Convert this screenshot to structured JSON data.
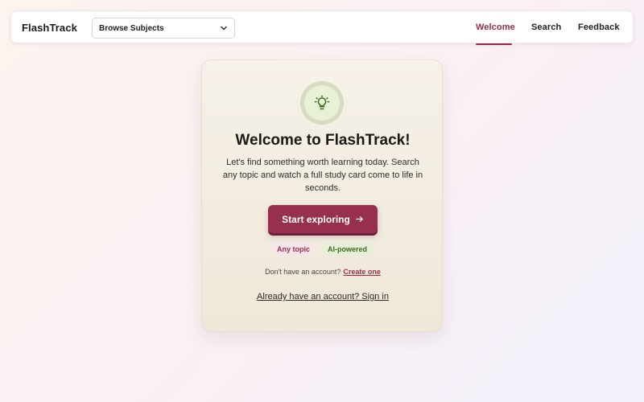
{
  "navbar": {
    "brand": "FlashTrack",
    "subject_select": {
      "selected": "Browse Subjects",
      "icon": "chevron-down-icon"
    },
    "links": [
      {
        "label": "Welcome",
        "active": true
      },
      {
        "label": "Search",
        "active": false
      },
      {
        "label": "Feedback",
        "active": false
      }
    ]
  },
  "welcome_card": {
    "icon": "lightbulb-icon",
    "title": "Welcome to FlashTrack!",
    "description": "Let's find something worth learning today. Search any topic and watch a full study card come to life in seconds.",
    "cta_label": "Start exploring",
    "cta_icon": "arrow-right-icon",
    "tags": [
      "Any topic",
      "AI-powered"
    ],
    "signup_prompt": "Don't have an account?",
    "signup_link": "Create one",
    "signin_link": "Already have an account? Sign in"
  },
  "colors": {
    "accent": "#97304f",
    "tag_pink_bg": "#f6e6ea",
    "tag_green_bg": "#e6efd8",
    "icon_green": "#3f6a1e"
  }
}
